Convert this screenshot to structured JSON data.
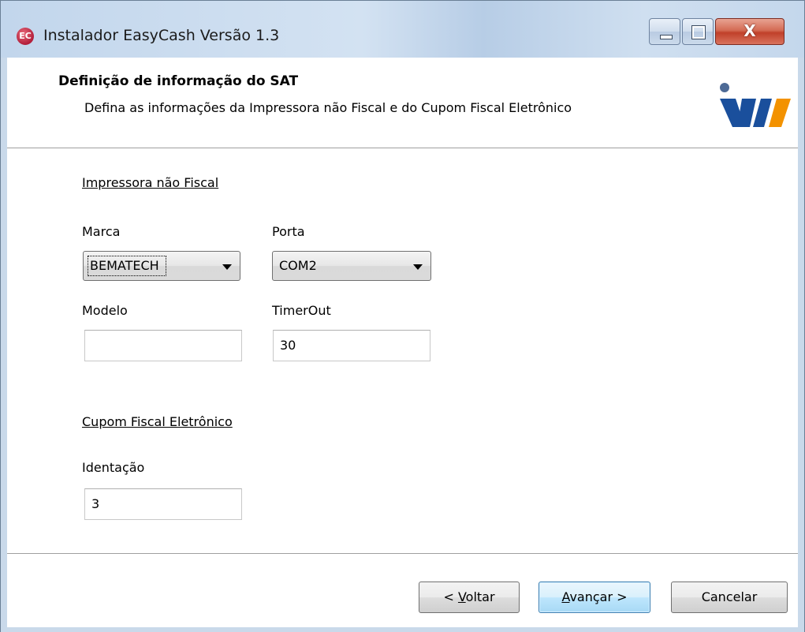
{
  "window": {
    "title": "Instalador EasyCash Versão 1.3",
    "icon_text": "EC",
    "close_glyph": "X"
  },
  "header": {
    "title": "Definição de informação do SAT",
    "subtitle": "Defina as informações da Impressora não Fiscal e do Cupom Fiscal Eletrônico"
  },
  "printer_section": {
    "heading": "Impressora não Fiscal",
    "marca_label": "Marca",
    "marca_value": "BEMATECH",
    "porta_label": "Porta",
    "porta_value": "COM2",
    "modelo_label": "Modelo",
    "modelo_value": "",
    "timerout_label": "TimerOut",
    "timerout_value": "30"
  },
  "cfe_section": {
    "heading": "Cupom Fiscal Eletrônico",
    "identacao_label": "Identação",
    "identacao_value": "3"
  },
  "footer": {
    "back_prefix": "< ",
    "back_accel": "V",
    "back_rest": "oltar",
    "next_accel": "A",
    "next_rest": "vançar >",
    "cancel_label": "Cancelar"
  },
  "colors": {
    "titlebar": "#c9d9ea",
    "close_button": "#c0402a",
    "logo_blue": "#1a4f9c",
    "logo_orange": "#f39200",
    "default_button_border": "#3c7fb1"
  },
  "icons": {
    "app": "easycash-app-icon",
    "minimize": "minimize-icon",
    "maximize": "maximize-icon",
    "close": "close-icon",
    "logo": "company-logo"
  }
}
